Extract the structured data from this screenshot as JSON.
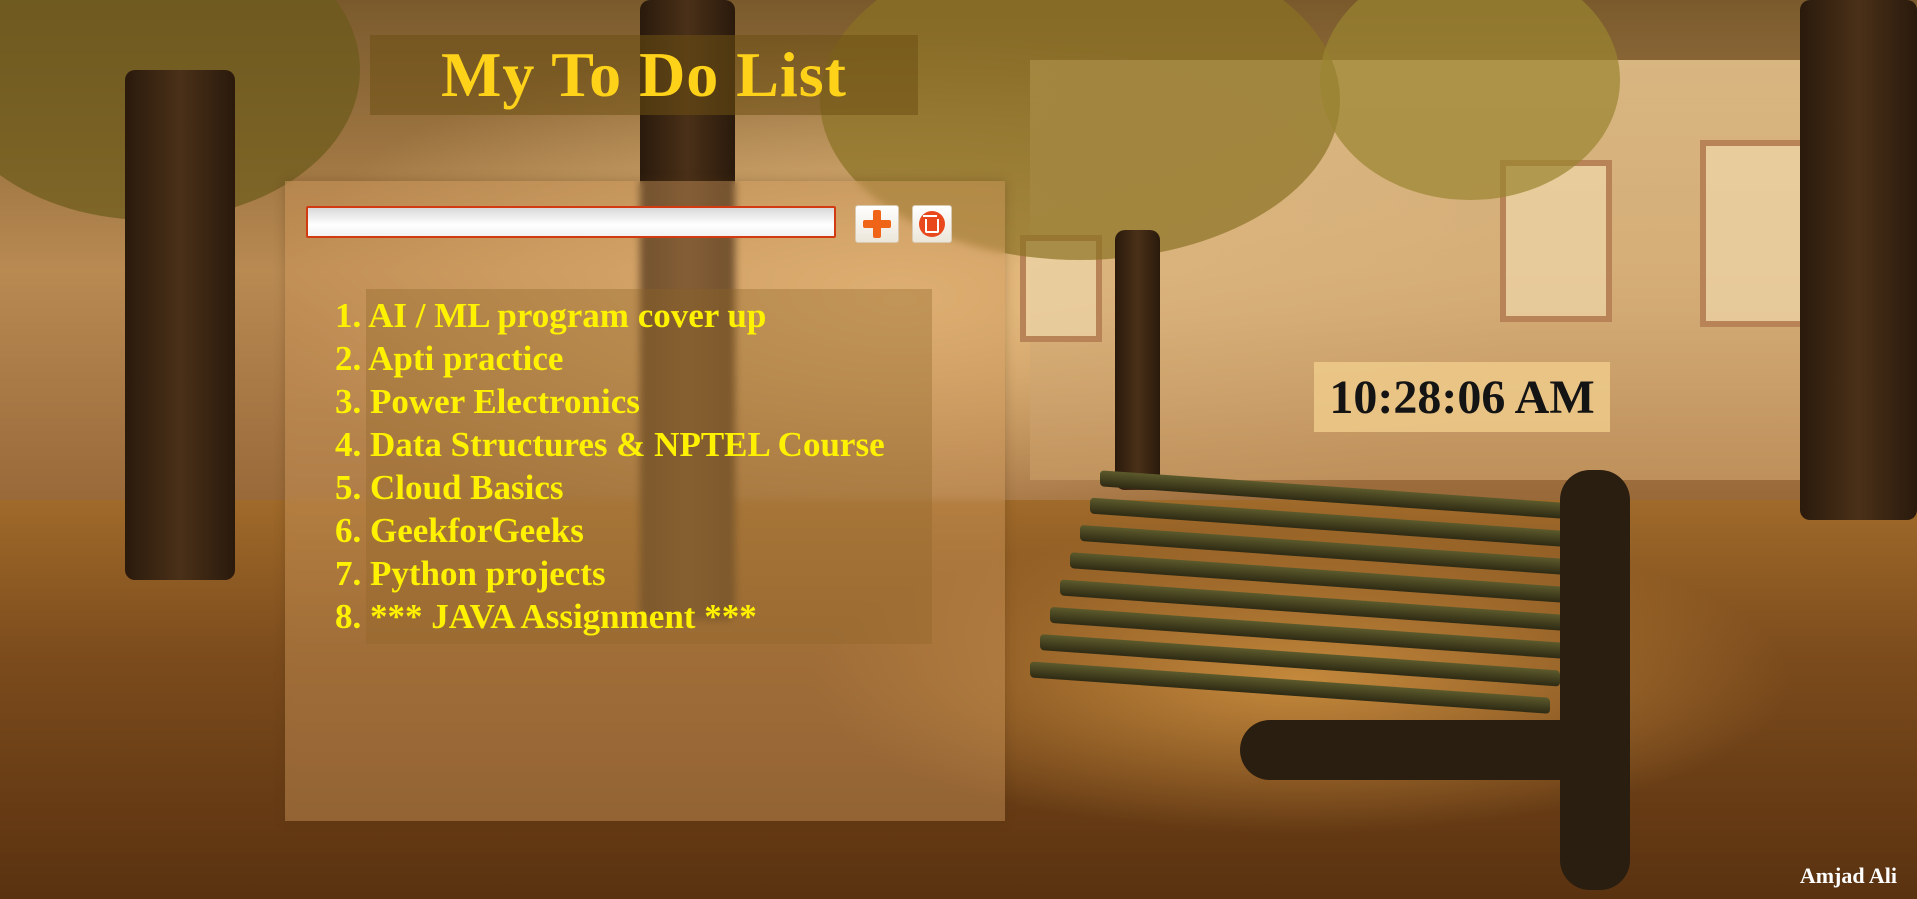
{
  "app": {
    "title": "My To Do List"
  },
  "input": {
    "value": "",
    "placeholder": ""
  },
  "buttons": {
    "add_icon": "plus-icon",
    "delete_icon": "trash-icon"
  },
  "tasks": [
    {
      "num": "1.",
      "text": "AI / ML program cover up"
    },
    {
      "num": "2.",
      "text": "Apti practice"
    },
    {
      "num": "3.",
      "text": "Power Electronics"
    },
    {
      "num": "4.",
      "text": "Data Structures & NPTEL Course"
    },
    {
      "num": "5.",
      "text": "Cloud Basics"
    },
    {
      "num": "6.",
      "text": "GeekforGeeks"
    },
    {
      "num": "7.",
      "text": "Python projects"
    },
    {
      "num": "8.",
      "text": "*** JAVA Assignment ***"
    }
  ],
  "clock": {
    "time": "10:28:06 AM"
  },
  "footer": {
    "author": "Amjad Ali"
  },
  "colors": {
    "title_text": "#ffd21a",
    "task_text": "#fff200",
    "add_button_accent": "#f06418",
    "delete_button_accent": "#e8481c",
    "input_border": "#d23a12"
  }
}
